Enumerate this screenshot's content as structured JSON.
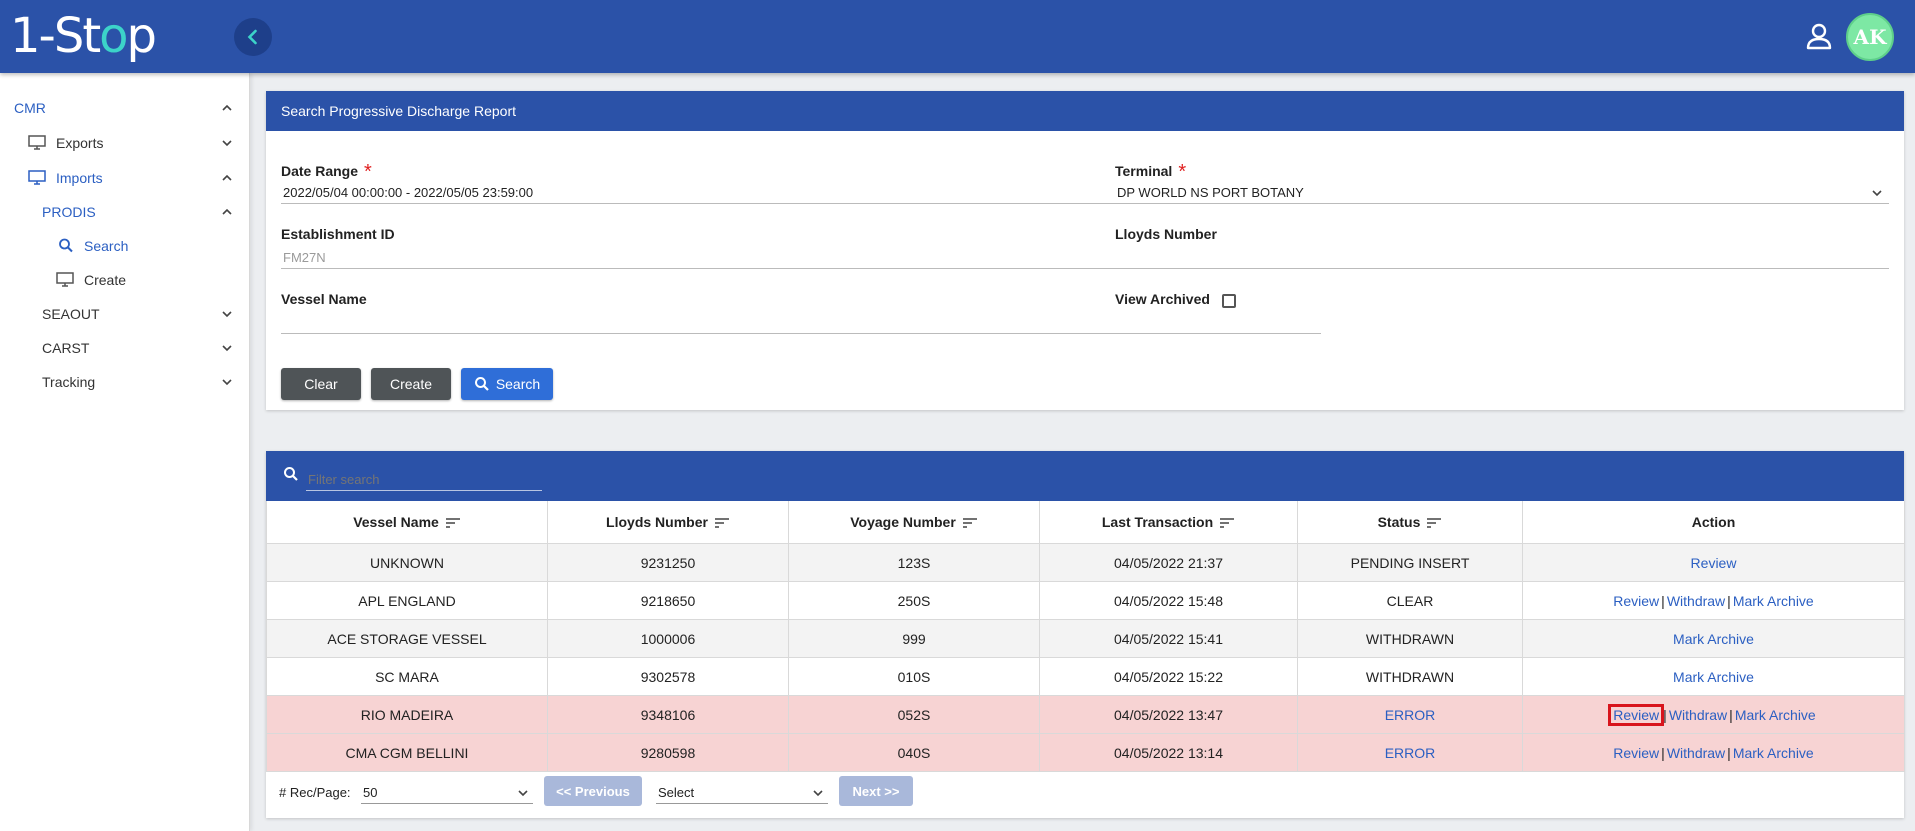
{
  "header": {
    "logo_prefix": "1-St",
    "logo_o": "o",
    "logo_suffix": "p",
    "avatar_initials": "AK"
  },
  "sidebar": {
    "cmr": "CMR",
    "exports": "Exports",
    "imports": "Imports",
    "prodis": "PRODIS",
    "search": "Search",
    "create": "Create",
    "seaout": "SEAOUT",
    "carst": "CARST",
    "tracking": "Tracking"
  },
  "search_panel": {
    "title": "Search Progressive Discharge Report",
    "date_range_label": "Date Range",
    "date_range_value": "2022/05/04 00:00:00 - 2022/05/05 23:59:00",
    "terminal_label": "Terminal",
    "terminal_value": "DP WORLD NS PORT BOTANY",
    "establishment_label": "Establishment ID",
    "establishment_value": "FM27N",
    "lloyds_label": "Lloyds Number",
    "lloyds_value": "",
    "vessel_label": "Vessel Name",
    "vessel_value": "",
    "view_archived_label": "View Archived",
    "clear_label": "Clear",
    "create_label": "Create",
    "search_label": "Search"
  },
  "results": {
    "filter_placeholder": "Filter search",
    "columns": [
      "Vessel Name",
      "Lloyds Number",
      "Voyage Number",
      "Last Transaction",
      "Status",
      "Action"
    ],
    "rows": [
      {
        "vessel": "UNKNOWN",
        "lloyds": "9231250",
        "voyage": "123S",
        "last": "04/05/2022 21:37",
        "status": "PENDING INSERT",
        "actions": [
          "Review"
        ]
      },
      {
        "vessel": "APL ENGLAND",
        "lloyds": "9218650",
        "voyage": "250S",
        "last": "04/05/2022 15:48",
        "status": "CLEAR",
        "actions": [
          "Review",
          "Withdraw",
          "Mark Archive"
        ]
      },
      {
        "vessel": "ACE STORAGE VESSEL",
        "lloyds": "1000006",
        "voyage": "999",
        "last": "04/05/2022 15:41",
        "status": "WITHDRAWN",
        "actions": [
          "Mark Archive"
        ]
      },
      {
        "vessel": "SC MARA",
        "lloyds": "9302578",
        "voyage": "010S",
        "last": "04/05/2022 15:22",
        "status": "WITHDRAWN",
        "actions": [
          "Mark Archive"
        ]
      },
      {
        "vessel": "RIO MADEIRA",
        "lloyds": "9348106",
        "voyage": "052S",
        "last": "04/05/2022 13:47",
        "status": "ERROR",
        "actions": [
          "Review",
          "Withdraw",
          "Mark Archive"
        ]
      },
      {
        "vessel": "CMA CGM BELLINI",
        "lloyds": "9280598",
        "voyage": "040S",
        "last": "04/05/2022 13:14",
        "status": "ERROR",
        "actions": [
          "Review",
          "Withdraw",
          "Mark Archive"
        ]
      }
    ],
    "action_separator": "|"
  },
  "pagination": {
    "rec_per_page_label": "# Rec/Page:",
    "rec_per_page_value": "50",
    "previous_label": "<< Previous",
    "page_select_value": "Select",
    "next_label": "Next >>"
  },
  "colors": {
    "header_blue": "#2b52a8",
    "link_blue": "#2b5fc2",
    "error_row": "#f7d3d3",
    "highlight_red": "#d8141c",
    "avatar_green": "#7de8a4"
  }
}
